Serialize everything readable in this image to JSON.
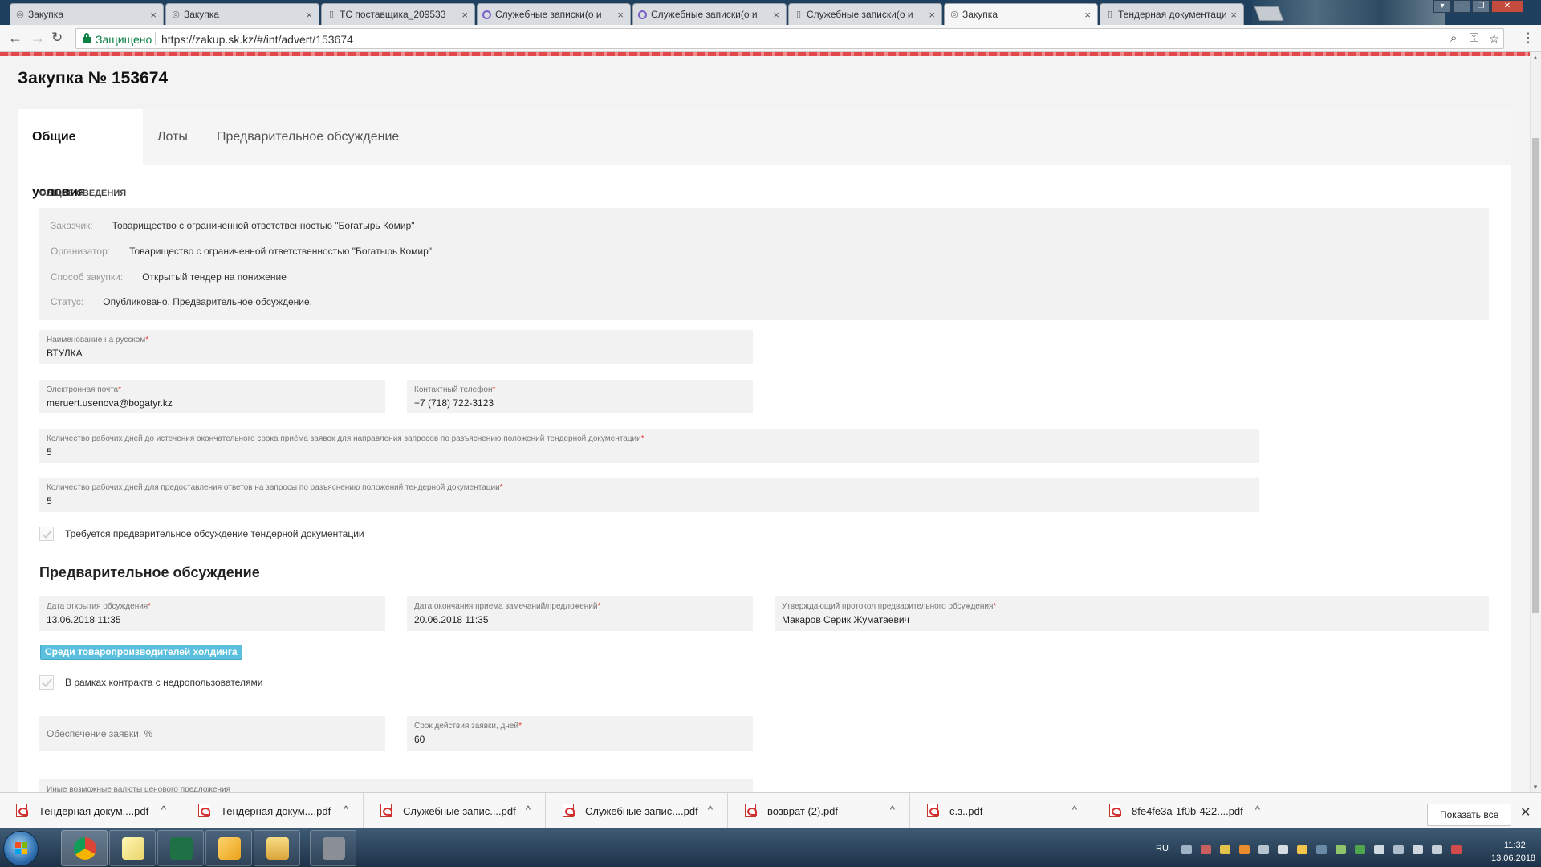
{
  "browser": {
    "tabs": [
      {
        "title": "Закупка"
      },
      {
        "title": "Закупка"
      },
      {
        "title": "ТС поставщика_209533"
      },
      {
        "title": "Служебные записки(о и"
      },
      {
        "title": "Служебные записки(о и"
      },
      {
        "title": "Служебные записки(о и"
      },
      {
        "title": "Закупка"
      },
      {
        "title": "Тендерная документаци"
      }
    ],
    "tab_close_glyph": "×",
    "secure_label": "Защищено",
    "url": "https://zakup.sk.kz/#/int/advert/153674"
  },
  "page": {
    "title": "Закупка № 153674",
    "tabs": [
      "Общие условия",
      "Лоты",
      "Предварительное обсуждение"
    ],
    "general_section_title": "ОБЩИЕ СВЕДЕНИЯ",
    "info": [
      {
        "label": "Заказчик:",
        "value": "Товарищество с ограниченной ответственностью \"Богатырь Комир\""
      },
      {
        "label": "Организатор:",
        "value": "Товарищество с ограниченной ответственностью \"Богатырь Комир\""
      },
      {
        "label": "Способ закупки:",
        "value": "Открытый тендер на понижение"
      },
      {
        "label": "Статус:",
        "value": "Опубликовано. Предварительное обсуждение."
      }
    ],
    "required_mark": "*",
    "fields": {
      "name_ru": {
        "label": "Наименование на русском",
        "value": "ВТУЛКА"
      },
      "email": {
        "label": "Электронная почта",
        "value": "meruert.usenova@bogatyr.kz"
      },
      "phone": {
        "label": "Контактный телефон",
        "value": "+7 (718) 722-3123"
      },
      "days_requests": {
        "label": "Количество рабочих дней до истечения окончательного срока приёма заявок для направления запросов по разъяснению положений тендерной документации",
        "value": "5"
      },
      "days_answers": {
        "label": "Количество рабочих дней для предоставления ответов на запросы по разъяснению положений тендерной документации",
        "value": "5"
      },
      "open_date": {
        "label": "Дата открытия обсуждения",
        "value": "13.06.2018 11:35"
      },
      "close_date": {
        "label": "Дата окончания приема замечаний/предложений",
        "value": "20.06.2018 11:35"
      },
      "approver": {
        "label": "Утверждающий протокол предварительного обсуждения",
        "value": "Макаров Серик Жуматаевич"
      },
      "security": {
        "placeholder": "Обеспечение заявки, %"
      },
      "validity": {
        "label": "Срок действия заявки, дней",
        "value": "60"
      },
      "currencies": {
        "label": "Иные возможные валюты ценового предложения"
      }
    },
    "checkbox_prediscussion": "Требуется предварительное обсуждение тендерной документации",
    "prediscussion_heading": "Предварительное обсуждение",
    "badge_holding": "Среди товаропроизводителей холдинга",
    "checkbox_subsoil": "В рамках контракта с недропользователями"
  },
  "downloads": {
    "items": [
      {
        "name": "Тендерная докум....pdf"
      },
      {
        "name": "Тендерная докум....pdf"
      },
      {
        "name": "Служебные запис....pdf"
      },
      {
        "name": "Служебные запис....pdf"
      },
      {
        "name": "возврат (2).pdf"
      },
      {
        "name": "с.з..pdf"
      },
      {
        "name": "8fe4fe3a-1f0b-422....pdf"
      }
    ],
    "caret": "^",
    "show_all": "Показать все",
    "close": "✕"
  },
  "taskbar": {
    "lang": "RU",
    "time": "11:32",
    "date": "13.06.2018"
  }
}
